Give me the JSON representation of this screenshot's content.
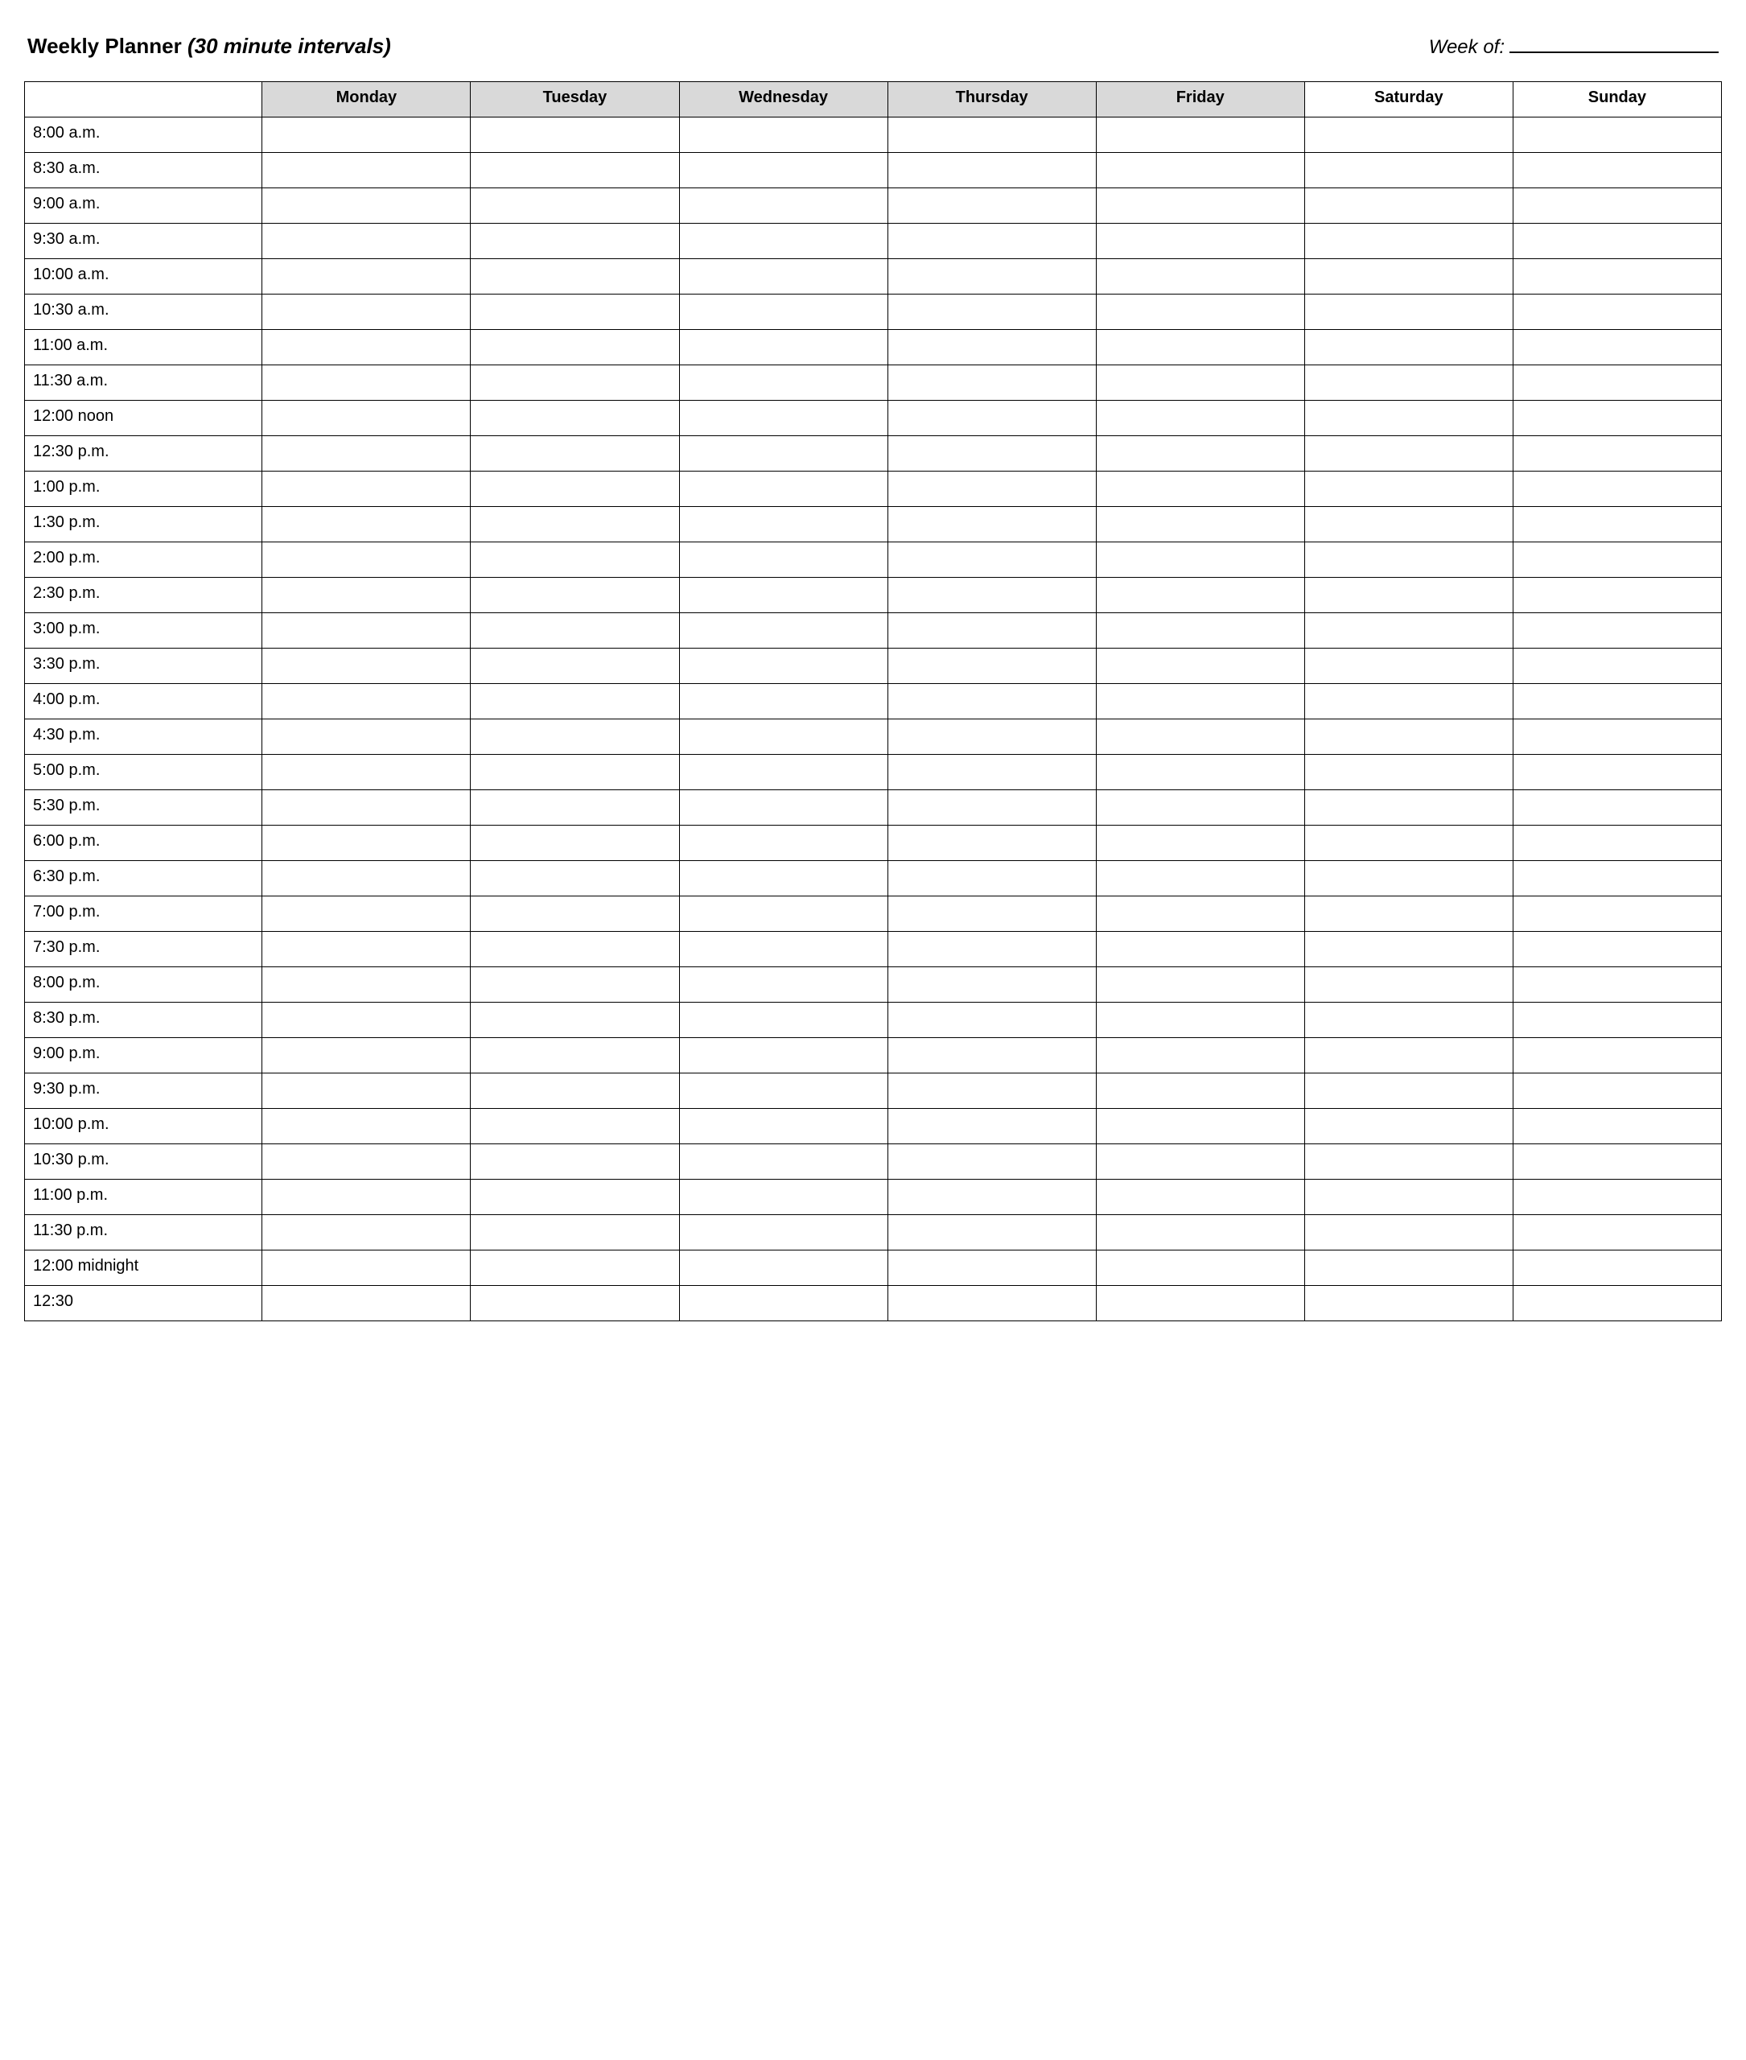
{
  "header": {
    "title_main": "Weekly Planner",
    "title_sub": "(30 minute intervals)",
    "week_of_label": "Week of:"
  },
  "days": [
    {
      "label": "Monday",
      "shaded": true
    },
    {
      "label": "Tuesday",
      "shaded": true
    },
    {
      "label": "Wednesday",
      "shaded": true
    },
    {
      "label": "Thursday",
      "shaded": true
    },
    {
      "label": "Friday",
      "shaded": true
    },
    {
      "label": "Saturday",
      "shaded": false
    },
    {
      "label": "Sunday",
      "shaded": false
    }
  ],
  "time_slots": [
    "8:00 a.m.",
    "8:30 a.m.",
    "9:00 a.m.",
    "9:30 a.m.",
    "10:00 a.m.",
    "10:30 a.m.",
    "11:00 a.m.",
    "11:30 a.m.",
    "12:00 noon",
    "12:30 p.m.",
    "1:00 p.m.",
    "1:30 p.m.",
    "2:00 p.m.",
    "2:30 p.m.",
    "3:00 p.m.",
    "3:30 p.m.",
    "4:00 p.m.",
    "4:30 p.m.",
    "5:00 p.m.",
    "5:30 p.m.",
    "6:00 p.m.",
    "6:30 p.m.",
    "7:00 p.m.",
    "7:30 p.m.",
    "8:00 p.m.",
    "8:30 p.m.",
    "9:00 p.m.",
    "9:30 p.m.",
    "10:00 p.m.",
    "10:30 p.m.",
    "11:00 p.m.",
    "11:30 p.m.",
    "12:00 midnight",
    "12:30"
  ]
}
